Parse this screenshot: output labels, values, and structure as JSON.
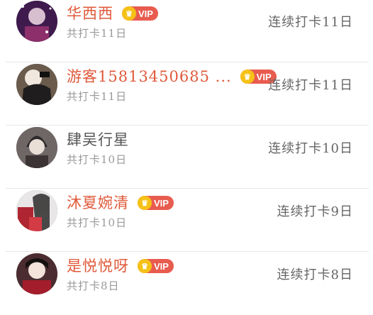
{
  "rows": [
    {
      "name": "华西西",
      "vip": "VIP",
      "sub": "共打卡11日",
      "streak": "连续打卡11日",
      "is_vip": true,
      "avatar_color": "#3f1a4d"
    },
    {
      "name": "游客15813450685 ...",
      "vip": "VIP",
      "sub": "共打卡11日",
      "streak": "连续打卡11日",
      "is_vip": true,
      "avatar_color": "#6b5b4c"
    },
    {
      "name": "肆吴行星",
      "vip": "",
      "sub": "共打卡10日",
      "streak": "连续打卡10日",
      "is_vip": false,
      "avatar_color": "#6f6666"
    },
    {
      "name": "沐夏婉清",
      "vip": "VIP",
      "sub": "共打卡10日",
      "streak": "连续打卡9日",
      "is_vip": true,
      "avatar_color": "#9d2a34"
    },
    {
      "name": "是悦悦呀",
      "vip": "VIP",
      "sub": "共打卡8日",
      "streak": "连续打卡8日",
      "is_vip": true,
      "avatar_color": "#4b2c30"
    }
  ],
  "icons": {
    "vip_crown": "crown-icon"
  },
  "colors": {
    "vip_name": "#e0593a",
    "vip_badge": "#e85c4f",
    "crown": "#f5c218",
    "plain_name": "#555555",
    "sub": "#999999",
    "streak": "#666666",
    "divider": "#e7e7e7"
  }
}
